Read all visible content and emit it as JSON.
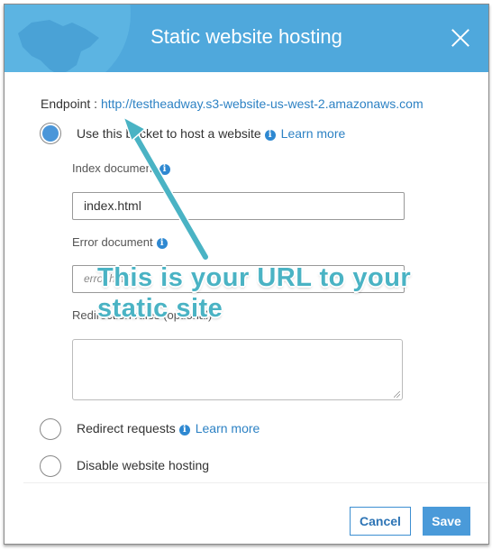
{
  "dialog": {
    "title": "Static website hosting",
    "close_icon": "close-icon"
  },
  "endpoint": {
    "label": "Endpoint :",
    "url": "http://testheadway.s3-website-us-west-2.amazonaws.com"
  },
  "options": [
    {
      "label": "Use this bucket to host a website",
      "checked": true,
      "learn_more": "Learn more",
      "info_icon": "info-icon"
    },
    {
      "label": "Redirect requests",
      "checked": false,
      "learn_more": "Learn more",
      "info_icon": "info-icon"
    },
    {
      "label": "Disable website hosting",
      "checked": false
    }
  ],
  "fields": {
    "index_label": "Index document",
    "index_value": "index.html",
    "error_label": "Error document",
    "error_placeholder": "error.html",
    "redirection_label": "Redirection rules (optional)",
    "redirection_value": ""
  },
  "footer": {
    "cancel_label": "Cancel",
    "save_label": "Save"
  },
  "annotation": {
    "line1": "This is your URL to your",
    "line2": "static site",
    "color": "#4ab3c4"
  },
  "colors": {
    "header": "#4fa8dc",
    "link": "#2d82c4",
    "primary": "#4a9ad9"
  }
}
